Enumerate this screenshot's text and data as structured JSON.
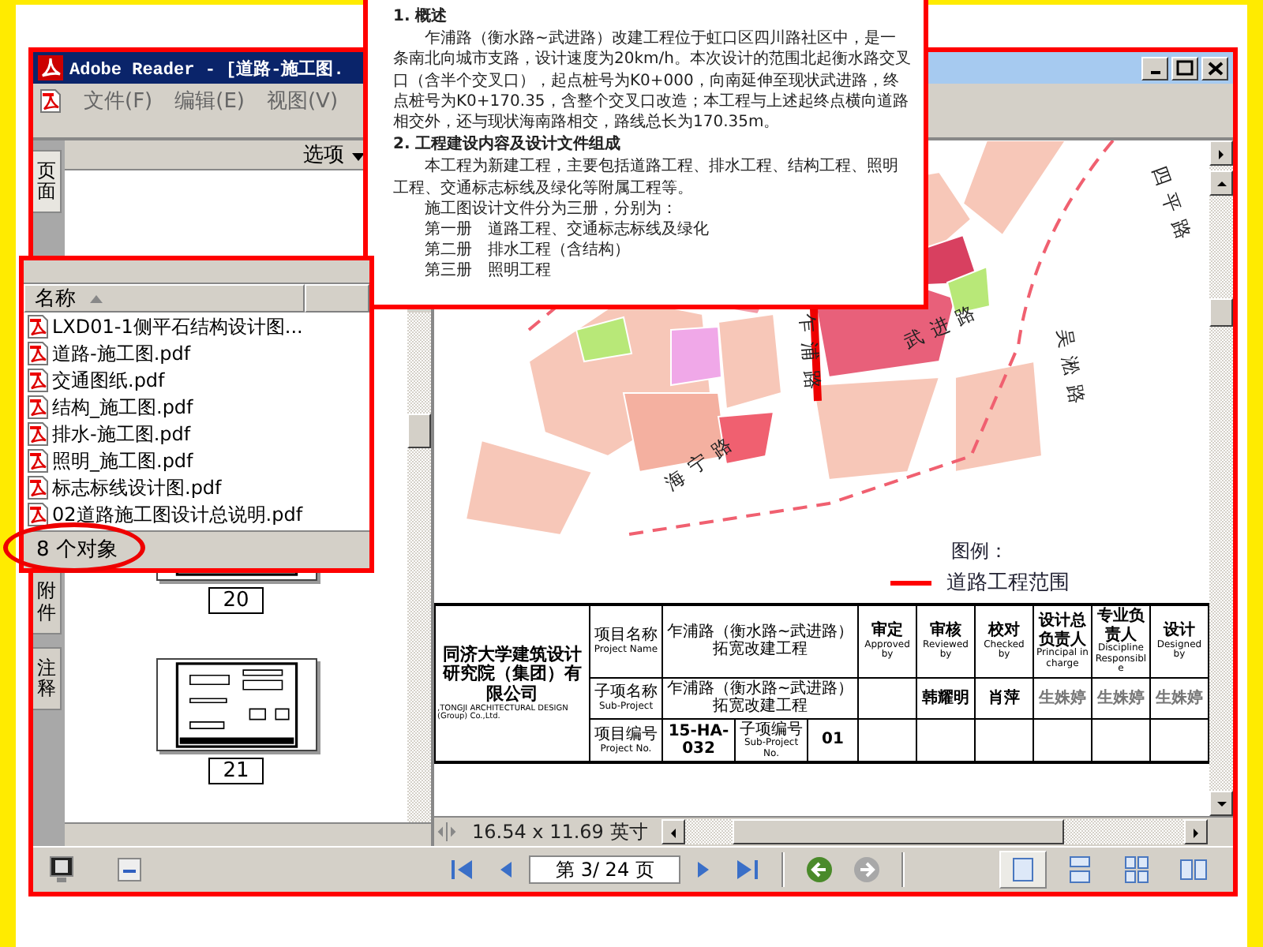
{
  "window": {
    "title": "Adobe Reader - [道路-施工图.",
    "menus": [
      "文件(F)",
      "编辑(E)",
      "视图(V)"
    ]
  },
  "side_tabs": [
    {
      "label": "页面",
      "selected": true
    },
    {
      "label": "附件",
      "selected": false
    },
    {
      "label": "注释",
      "selected": false
    }
  ],
  "pages_panel": {
    "options_label": "选项",
    "thumbnails": [
      {
        "label": "20"
      },
      {
        "label": "21"
      }
    ]
  },
  "document": {
    "map_labels": [
      "四平路",
      "吴淞路",
      "乍浦路",
      "武进路",
      "海宁路"
    ],
    "legend": {
      "title": "图例：",
      "items": [
        {
          "label": "道路工程范围",
          "color": "#ff0000"
        }
      ]
    },
    "title_block": {
      "company": "同济大学建筑设计研究院（集团）有限公司",
      "company_en": ",TONGJI ARCHITECTURAL DESIGN (Group) Co.,Ltd.",
      "fields": [
        {
          "label": "项目名称",
          "label_en": "Project Name",
          "value": "乍浦路（衡水路~武进路）拓宽改建工程"
        },
        {
          "label": "子项名称",
          "label_en": "Sub-Project",
          "value": "乍浦路（衡水路~武进路）拓宽改建工程"
        }
      ],
      "numbers": [
        {
          "label": "项目编号",
          "label_en": "Project No.",
          "value": "15-HA-032"
        },
        {
          "label": "子项编号",
          "label_en": "Sub-Project No.",
          "value": "01"
        }
      ],
      "signoffs": [
        {
          "role": "审定",
          "role_en": "Approved by"
        },
        {
          "role": "审核",
          "role_en": "Reviewed by",
          "name": "韩耀明"
        },
        {
          "role": "校对",
          "role_en": "Checked by",
          "name": "肖萍"
        },
        {
          "role": "设计总负责人",
          "role_en": "Principal in charge",
          "name": "生姝婷"
        },
        {
          "role": "专业负责人",
          "role_en": "Discipline Responsible",
          "name": "生姝婷"
        },
        {
          "role": "设计",
          "role_en": "Designed by",
          "name": "生姝婷"
        }
      ]
    }
  },
  "status": {
    "page_size": "16.54 x 11.69 英寸"
  },
  "navigation": {
    "page": "第 3/ 24 页",
    "history": [
      {
        "kind": "back",
        "disabled": false
      },
      {
        "kind": "forward",
        "disabled": true
      }
    ]
  },
  "view_buttons": [
    {
      "kind": "single",
      "selected": true
    },
    {
      "kind": "continuous",
      "selected": false
    },
    {
      "kind": "grid",
      "selected": false
    },
    {
      "kind": "facing",
      "selected": false
    }
  ],
  "excerpt": {
    "sections": [
      {
        "heading": "1. 概述",
        "paragraphs": [
          "乍浦路（衡水路~武进路）改建工程位于虹口区四川路社区中，是一条南北向城市支路，设计速度为20km/h。本次设计的范围北起衡水路交叉口（含半个交叉口），起点桩号为K0+000，向南延伸至现状武进路，终点桩号为K0+170.35，含整个交叉口改造；本工程与上述起终点横向道路相交外，还与现状海南路相交，路线总长为170.35m。"
        ]
      },
      {
        "heading": "2. 工程建设内容及设计文件组成",
        "paragraphs": [
          "本工程为新建工程，主要包括道路工程、排水工程、结构工程、照明工程、交通标志标线及绿化等附属工程等。",
          "施工图设计文件分为三册，分别为：",
          "第一册　道路工程、交通标志标线及绿化",
          "第二册　排水工程（含结构）",
          "第三册　照明工程"
        ]
      }
    ]
  },
  "file_list": {
    "column": "名称",
    "files": [
      "LXD01-1侧平石结构设计图...",
      "道路-施工图.pdf",
      "交通图纸.pdf",
      "结构_施工图.pdf",
      "排水-施工图.pdf",
      "照明_施工图.pdf",
      "标志标线设计图.pdf",
      "02道路施工图设计总说明.pdf"
    ],
    "status": "8 个对象"
  }
}
